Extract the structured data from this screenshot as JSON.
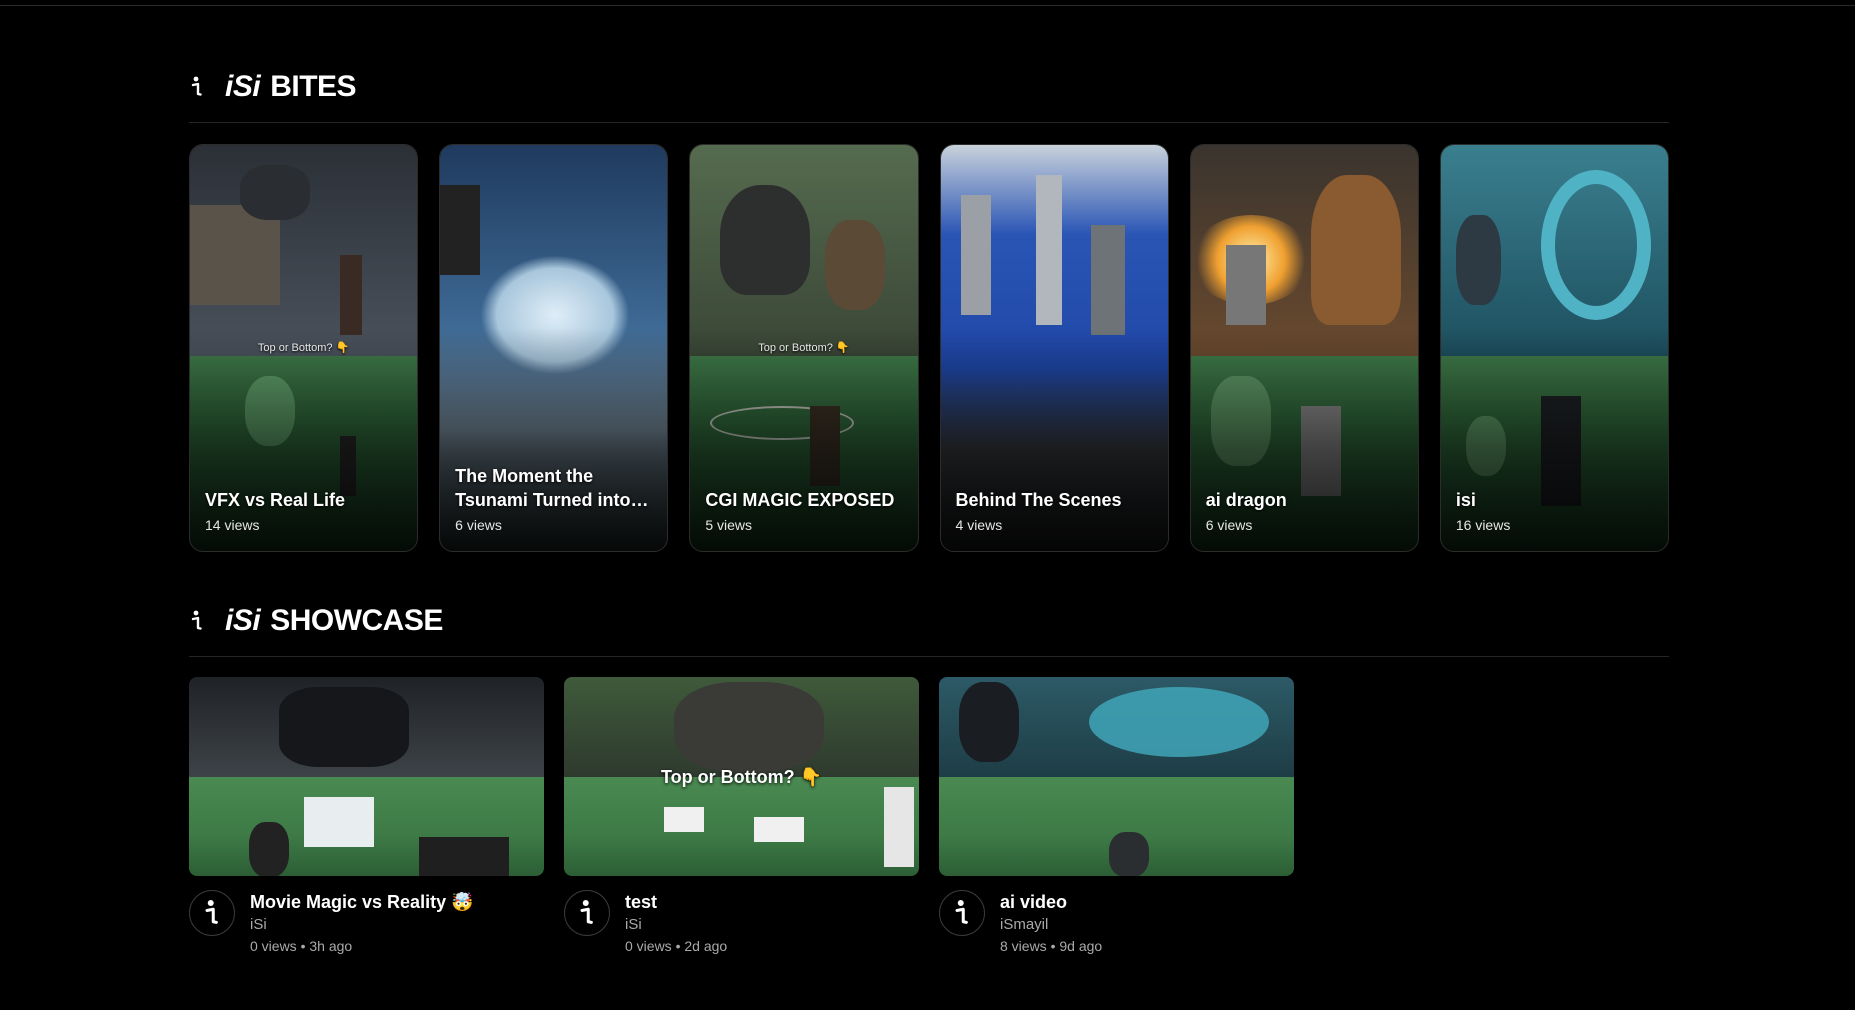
{
  "bites": {
    "brand": "iSi",
    "title": "BITES",
    "items": [
      {
        "title": "VFX vs Real Life",
        "views": "14 views",
        "overlay": "Top or Bottom? 👇",
        "top_color": "#3a4048",
        "accent": "#586270"
      },
      {
        "title": "The Moment the Tsunami Turned into…",
        "views": "6 views",
        "overlay": "",
        "top_color": "#2a4f7e",
        "accent": "#b9d3e8"
      },
      {
        "title": "CGI MAGIC EXPOSED",
        "views": "5 views",
        "overlay": "Top or Bottom? 👇",
        "top_color": "#3d4a3a",
        "accent": "#5f6b57"
      },
      {
        "title": "Behind The Scenes",
        "views": "4 views",
        "overlay": "",
        "top_color": "#2850a8",
        "accent": "#8a8f96"
      },
      {
        "title": "ai dragon",
        "views": "6 views",
        "overlay": "",
        "top_color": "#6a4a2e",
        "accent": "#e39a3a"
      },
      {
        "title": "isi",
        "views": "16 views",
        "overlay": "",
        "top_color": "#2d6b7a",
        "accent": "#5ab5c6"
      }
    ]
  },
  "showcase": {
    "brand": "iSi",
    "title": "SHOWCASE",
    "items": [
      {
        "title": "Movie Magic vs Reality 🤯",
        "channel": "iSi",
        "stats": "0 views • 3h ago",
        "overlay": "",
        "top_color": "#2f3338"
      },
      {
        "title": "test",
        "channel": "iSi",
        "stats": "0 views • 2d ago",
        "overlay": "Top or Bottom? 👇",
        "top_color": "#3a4a36"
      },
      {
        "title": "ai video",
        "channel": "iSmayil",
        "stats": "8 views • 9d ago",
        "overlay": "",
        "top_color": "#2c5a66"
      }
    ]
  }
}
